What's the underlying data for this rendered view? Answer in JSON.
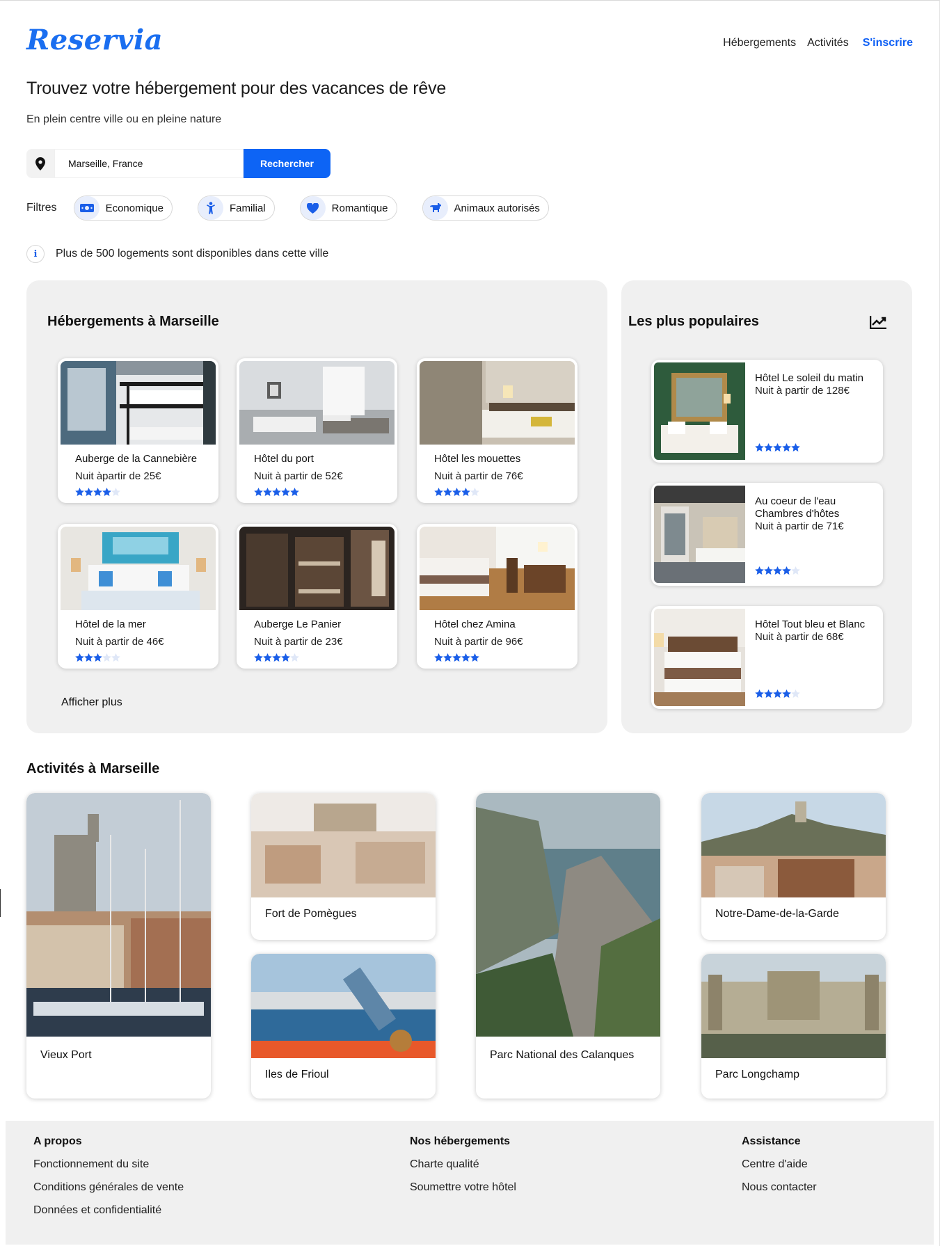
{
  "header": {
    "logo": "Reservia",
    "nav": {
      "accommodations": "Hébergements",
      "activities": "Activités",
      "signup": "S'inscrire"
    }
  },
  "hero": {
    "title": "Trouvez votre hébergement pour des vacances de rêve",
    "subtitle": "En plein centre ville ou en pleine nature"
  },
  "search": {
    "value": "Marseille, France",
    "button": "Rechercher",
    "icon": "location-pin-icon"
  },
  "filters": {
    "label": "Filtres",
    "items": [
      {
        "label": "Economique",
        "icon": "money-icon"
      },
      {
        "label": "Familial",
        "icon": "child-icon"
      },
      {
        "label": "Romantique",
        "icon": "heart-icon"
      },
      {
        "label": "Animaux autorisés",
        "icon": "dog-icon"
      }
    ]
  },
  "info": {
    "icon": "info-icon",
    "text": "Plus de 500 logements sont disponibles dans cette ville"
  },
  "accommodations": {
    "title": "Hébergements à Marseille",
    "more": "Afficher plus",
    "items": [
      {
        "name": "Auberge de la Cannebière",
        "price": "Nuit àpartir de 25€",
        "rating": 4
      },
      {
        "name": "Hôtel du port",
        "price": "Nuit à partir de 52€",
        "rating": 5
      },
      {
        "name": "Hôtel les mouettes",
        "price": "Nuit à partir de 76€",
        "rating": 4
      },
      {
        "name": "Hôtel de la mer",
        "price": "Nuit à partir de 46€",
        "rating": 3
      },
      {
        "name": "Auberge Le Panier",
        "price": "Nuit à partir de 23€",
        "rating": 4
      },
      {
        "name": "Hôtel chez Amina",
        "price": "Nuit à partir de 96€",
        "rating": 5
      }
    ]
  },
  "popular": {
    "title": "Les plus populaires",
    "icon": "trending-up-icon",
    "items": [
      {
        "name": "Hôtel Le soleil du matin",
        "price": "Nuit à partir de 128€",
        "rating": 5
      },
      {
        "name": "Au coeur de l'eau Chambres d'hôtes",
        "price": "Nuit à partir de 71€",
        "rating": 4
      },
      {
        "name": "Hôtel Tout bleu et Blanc",
        "price": "Nuit à partir de 68€",
        "rating": 4
      }
    ]
  },
  "activities": {
    "title": "Activités à Marseille",
    "items": [
      {
        "label": "Vieux Port"
      },
      {
        "label": "Fort de Pomègues"
      },
      {
        "label": "Iles de Frioul"
      },
      {
        "label": "Parc National des Calanques"
      },
      {
        "label": "Notre-Dame-de-la-Garde"
      },
      {
        "label": "Parc Longchamp"
      }
    ]
  },
  "footer": {
    "col1": {
      "heading": "A propos",
      "links": [
        "Fonctionnement du site",
        "Conditions générales de vente",
        "Données et confidentialité"
      ]
    },
    "col2": {
      "heading": "Nos hébergements",
      "links": [
        "Charte qualité",
        "Soumettre votre hôtel"
      ]
    },
    "col3": {
      "heading": "Assistance",
      "links": [
        "Centre d'aide",
        "Nous contacter"
      ]
    }
  },
  "colors": {
    "brand": "#0d64f5",
    "panel": "#f0f0f0",
    "star_on": "#1a5ee8",
    "star_off": "#dfe7f7"
  }
}
